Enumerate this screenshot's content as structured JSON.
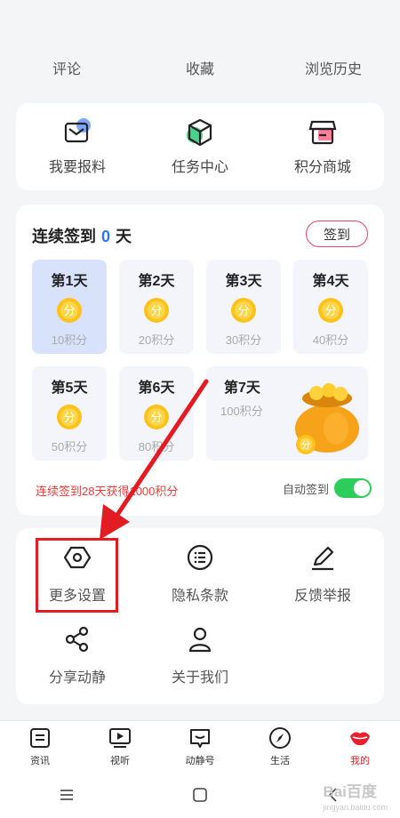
{
  "stats": [
    "评论",
    "收藏",
    "浏览历史"
  ],
  "quick_actions": [
    {
      "label": "我要报料",
      "icon": "mail-icon"
    },
    {
      "label": "任务中心",
      "icon": "cube-icon"
    },
    {
      "label": "积分商城",
      "icon": "store-icon"
    }
  ],
  "signin": {
    "prefix": "连续签到",
    "count": "0",
    "suffix": "天",
    "button": "签到",
    "coin_text": "分",
    "days": [
      {
        "title": "第1天",
        "points": "10积分"
      },
      {
        "title": "第2天",
        "points": "20积分"
      },
      {
        "title": "第3天",
        "points": "30积分"
      },
      {
        "title": "第4天",
        "points": "40积分"
      },
      {
        "title": "第5天",
        "points": "50积分"
      },
      {
        "title": "第6天",
        "points": "80积分"
      },
      {
        "title": "第7天",
        "points": "100积分"
      }
    ],
    "bonus_text": "连续签到28天获得1000积分",
    "auto_label": "自动签到",
    "auto_on": true
  },
  "settings": [
    {
      "label": "更多设置",
      "icon": "hexagon-settings-icon"
    },
    {
      "label": "隐私条款",
      "icon": "list-circle-icon"
    },
    {
      "label": "反馈举报",
      "icon": "pencil-icon"
    },
    {
      "label": "分享动静",
      "icon": "share-icon"
    },
    {
      "label": "关于我们",
      "icon": "person-icon"
    }
  ],
  "nav": [
    {
      "label": "资讯",
      "icon": "news-icon"
    },
    {
      "label": "视听",
      "icon": "video-icon"
    },
    {
      "label": "动静号",
      "icon": "chat-icon"
    },
    {
      "label": "生活",
      "icon": "compass-icon"
    },
    {
      "label": "我的",
      "icon": "lips-icon",
      "active": true
    }
  ],
  "watermark": {
    "main": "Bai百度",
    "sub": "jingyan.baidu.com"
  },
  "colors": {
    "accent": "#2f74ff",
    "red": "#e8202e",
    "toggle": "#2ecc5a"
  }
}
